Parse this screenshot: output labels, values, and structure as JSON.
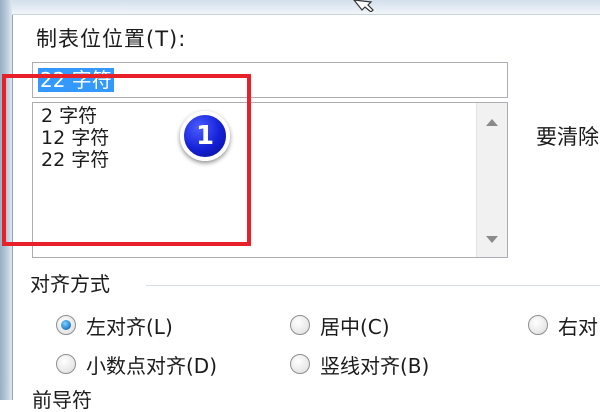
{
  "tab_stops": {
    "position_label": "制表位位置(T):",
    "position_value": "22 字符",
    "list_items": [
      "2 字符",
      "12 字符",
      "22 字符"
    ],
    "clear_label": "要清除"
  },
  "annotation": {
    "badge_number": "1",
    "highlight_color": "#e8202a",
    "badge_color": "#1320d6"
  },
  "alignment": {
    "legend": "对齐方式",
    "options": [
      {
        "label": "左对齐(L)",
        "checked": true
      },
      {
        "label": "居中(C)",
        "checked": false
      },
      {
        "label": "右对",
        "checked": false
      },
      {
        "label": "小数点对齐(D)",
        "checked": false
      },
      {
        "label": "竖线对齐(B)",
        "checked": false
      }
    ]
  },
  "leader_section_label": "前导符"
}
